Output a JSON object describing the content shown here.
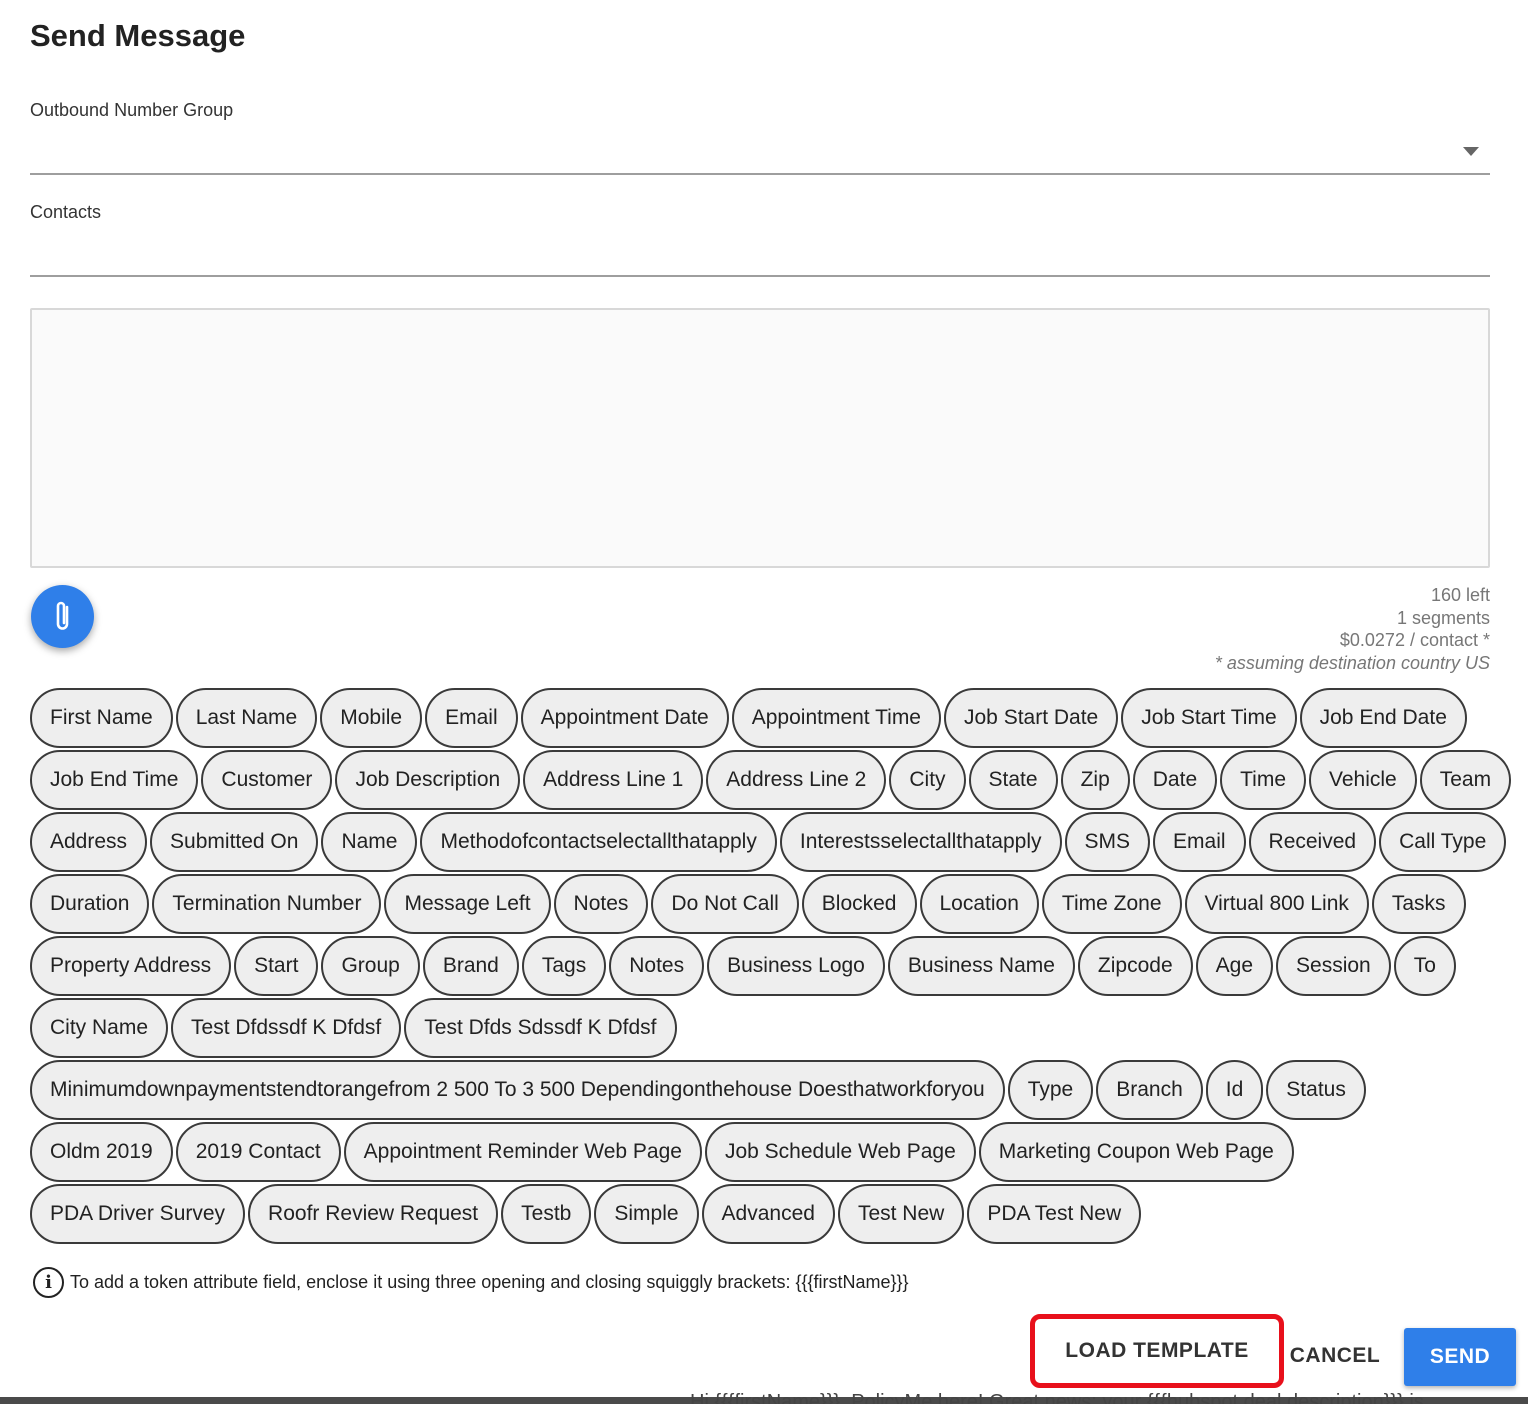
{
  "title": "Send Message",
  "outbound_group": {
    "label": "Outbound Number Group",
    "value": ""
  },
  "contacts": {
    "label": "Contacts",
    "value": ""
  },
  "message": {
    "value": ""
  },
  "stats": {
    "left": "160 left",
    "segments": "1 segments",
    "cost": "$0.0272 / contact *",
    "note": "* assuming destination country US"
  },
  "token_rows": [
    [
      "First Name",
      "Last Name",
      "Mobile",
      "Email",
      "Appointment Date",
      "Appointment Time",
      "Job Start Date",
      "Job Start Time",
      "Job End Date"
    ],
    [
      "Job End Time",
      "Customer",
      "Job Description",
      "Address Line 1",
      "Address Line 2",
      "City",
      "State",
      "Zip",
      "Date",
      "Time",
      "Vehicle",
      "Team"
    ],
    [
      "Address",
      "Submitted On",
      "Name",
      "Methodofcontactselectallthatapply",
      "Interestsselectallthatapply",
      "SMS",
      "Email",
      "Received",
      "Call Type"
    ],
    [
      "Duration",
      "Termination Number",
      "Message Left",
      "Notes",
      "Do Not Call",
      "Blocked",
      "Location",
      "Time Zone",
      "Virtual 800 Link",
      "Tasks"
    ],
    [
      "Property Address",
      "Start",
      "Group",
      "Brand",
      "Tags",
      "Notes",
      "Business Logo",
      "Business Name",
      "Zipcode",
      "Age",
      "Session",
      "To"
    ],
    [
      "City Name",
      "Test Dfdssdf K Dfdsf",
      "Test Dfds Sdssdf K Dfdsf"
    ],
    [
      "Minimumdownpaymentstendtorangefrom 2 500 To 3 500 Dependingonthehouse Doesthatworkforyou",
      "Type",
      "Branch",
      "Id",
      "Status"
    ],
    [
      "Oldm 2019",
      "2019 Contact",
      "Appointment Reminder Web Page",
      "Job Schedule Web Page",
      "Marketing Coupon Web Page"
    ],
    [
      "PDA Driver Survey",
      "Roofr Review Request",
      "Testb",
      "Simple",
      "Advanced",
      "Test New",
      "PDA Test New"
    ]
  ],
  "info_text": "To add a token attribute field, enclose it using three opening and closing squiggly brackets: {{{firstName}}}",
  "buttons": {
    "load_template": "LOAD TEMPLATE",
    "cancel": "CANCEL",
    "send": "SEND"
  },
  "background_bleed_text": "Hi {{{firstName}}}, PolicyMe here! Great news: your {{{hubspot.deal.description}}} is",
  "colors": {
    "primary": "#2f7fe9",
    "highlight_box": "#e8101b"
  },
  "icons": {
    "attach": "paperclip-icon",
    "info": "info-icon",
    "dropdown": "chevron-down-icon"
  }
}
